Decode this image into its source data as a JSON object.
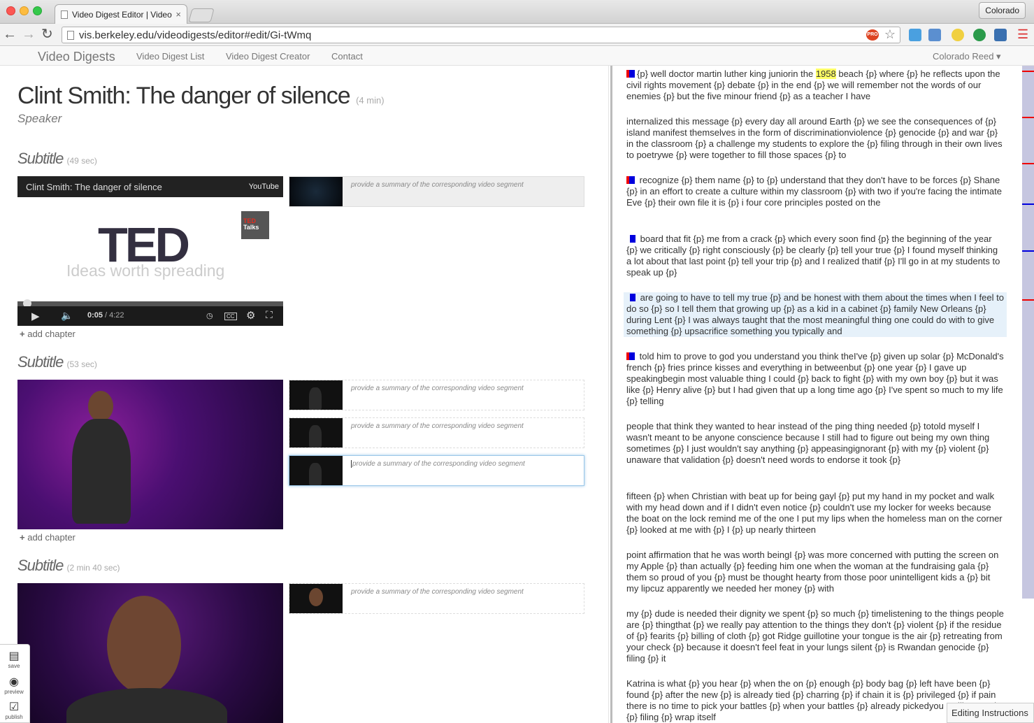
{
  "browser": {
    "tab_title": "Video Digest Editor | Video",
    "tab_close": "×",
    "profile_name": "Colorado",
    "url": "vis.berkeley.edu/videodigests/editor#edit/Gi-tWmq",
    "pro_badge": "PRO"
  },
  "nav": {
    "brand": "Video Digests",
    "links": [
      "Video Digest List",
      "Video Digest Creator",
      "Contact"
    ],
    "user": "Colorado Reed ▾"
  },
  "digest": {
    "title": "Clint Smith: The danger of silence",
    "duration": "(4 min)",
    "speaker": "Speaker"
  },
  "sections": [
    {
      "heading": "Subtitle",
      "duration": "(49 sec)"
    },
    {
      "heading": "Subtitle",
      "duration": "(53 sec)"
    },
    {
      "heading": "Subtitle",
      "duration": "(2 min 40 sec)"
    }
  ],
  "player": {
    "title": "Clint Smith: The danger of silence",
    "brand": "YouTube",
    "logo": "TED",
    "badge_top": "TED",
    "badge_bottom": "Talks",
    "slogan": "Ideas worth spreading",
    "time_current": "0:05",
    "time_total": " / 4:22",
    "progress_fraction": 0.02
  },
  "add_chapter": "add chapter",
  "segment_placeholder": "provide a summary of the corresponding video segment",
  "tools": [
    {
      "label": "save",
      "icon": "save-icon"
    },
    {
      "label": "preview",
      "icon": "eye-icon"
    },
    {
      "label": "publish",
      "icon": "check-icon"
    }
  ],
  "editing_instructions": "Editing Instructions",
  "transcript": [
    {
      "markers": "rb",
      "pre": "{p} well doctor martin luther king juniorin the ",
      "hl": "1958",
      "post": " beach {p} where {p} he reflects upon the civil rights movement {p} debate {p} in the end {p} we will remember not the words of our enemies {p} but the five minour friend {p} as a teacher I have"
    },
    {
      "markers": "",
      "pre": "internalized this message {p} every day all around Earth {p} we see the consequences of {p} island manifest themselves in the form of discriminationviolence {p} genocide {p} and war {p} in the classroom {p} a challenge my students to explore the {p} filing through in their own lives to poetrywe {p} were together to fill those spaces {p} to",
      "hl": "",
      "post": ""
    },
    {
      "markers": "rb",
      "pre": " recognize {p} them name {p} to {p} understand that they don't have to be forces {p} Shane {p} in an effort to create a culture within my classroom {p} with two if you're facing the intimate Eve {p} their own file it is {p} i four core principles posted on the",
      "hl": "",
      "post": ""
    },
    {
      "markers": "b",
      "pre": " board that fit {p} me from a crack {p} which every soon find {p} the beginning of the year {p} we critically {p} right consciously {p} be clearly {p} tell your true {p} I found myself thinking a lot about that last point {p} tell your trip {p} and I realized thatif {p} I'll go in at my students to speak up {p}",
      "hl": "",
      "post": ""
    },
    {
      "markers": "b",
      "pre": " are going to have to tell my true {p} and be honest with them about the times when I feel to do so {p} so I tell them that growing up {p} as a kid in a cabinet {p} family New Orleans {p} during Lent {p} I was always taught that the most meaningful thing one could do with to give something {p} upsacrifice something you typically and",
      "hl": "",
      "post": ""
    },
    {
      "markers": "rb",
      "pre": " told him to prove to god you understand you think theI've {p} given up solar {p} McDonald's french {p} fries prince kisses and everything in betweenbut {p} one year {p} I gave up speakingbegin most valuable thing I could {p} back to fight {p} with my own boy {p} but it was like {p} Henry alive {p} but I had given that up a long time ago {p} I've spent so much to my life {p} telling",
      "hl": "",
      "post": ""
    },
    {
      "markers": "",
      "pre": "people that think they wanted to hear instead of the ping thing needed {p} totold myself I wasn't meant to be anyone conscience because I still had to figure out being my own thing sometimes {p} I just wouldn't say anything {p} appeasingignorant {p} with my {p} violent {p} unaware that validation {p} doesn't need words to endorse it took {p}",
      "hl": "",
      "post": ""
    },
    {
      "markers": "",
      "pre": "fifteen {p} when Christian with beat up for being gayl {p} put my hand in my pocket and walk with my head down and if I didn't even notice {p} couldn't use my locker for weeks because the boat on the lock remind me of the one I put my lips when the homeless man on the corner {p} looked at me with {p} I {p} up nearly thirteen",
      "hl": "",
      "post": ""
    },
    {
      "markers": "",
      "pre": "point affirmation that he was worth beingI {p} was more concerned with putting the screen on my Apple {p} than actually {p} feeding him one when the woman at the fundraising gala {p} them so proud of you {p} must be thought hearty from those poor unintelligent kids a {p} bit my lipcuz apparently we needed her money {p} with",
      "hl": "",
      "post": ""
    },
    {
      "markers": "",
      "pre": "my {p} dude is needed their dignity we spent {p} so much {p} timelistening to the things people are {p} thingthat {p} we really pay attention to the things they don't {p} violent {p} if the residue of {p} fearits {p} billing of cloth {p} got Ridge guillotine your tongue is the air {p} retreating from your check {p} because it doesn't feel feat in your lungs silent {p} is Rwandan genocide {p} filing {p} it",
      "hl": "",
      "post": ""
    },
    {
      "markers": "",
      "pre": "Katrina is what {p} you hear {p} when the on {p} enough {p} body bag {p} left have been {p} found {p} after the new {p} is already tied {p} charring {p} if chain it is {p} privileged {p} if pain there is no time to pick your battles {p} when your battles {p} already pickedyou I will not make {p} filing {p} wrap itself",
      "hl": "",
      "post": ""
    }
  ],
  "colors": {
    "marker_red": "#e00000",
    "marker_blue": "#0000dd",
    "highlight": "#ffff66",
    "selected_para": "#e6f1fa"
  }
}
